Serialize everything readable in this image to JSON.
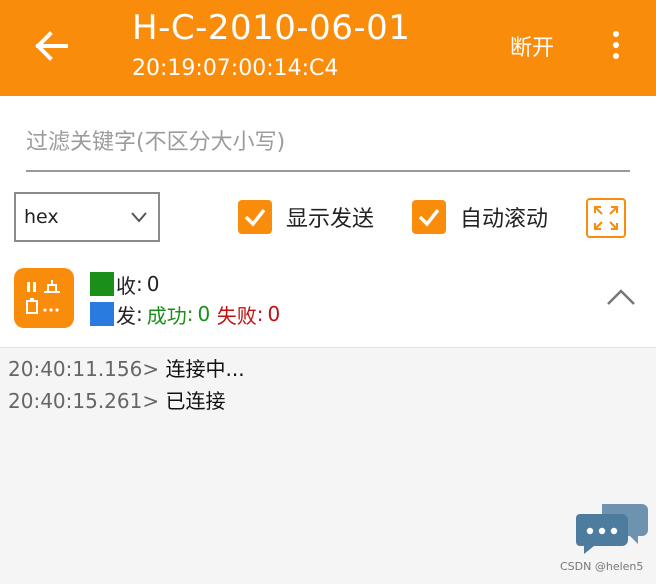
{
  "app_bar": {
    "title": "H-C-2010-06-01",
    "subtitle": "20:19:07:00:14:C4",
    "disconnect_label": "断开",
    "back_icon": "arrow-left-icon",
    "more_icon": "more-vert-icon",
    "color": "#f98c0a"
  },
  "filter": {
    "placeholder": "过滤关键字(不区分大小写)",
    "value": ""
  },
  "controls": {
    "format_select": {
      "selected": "hex"
    },
    "show_send": {
      "label": "显示发送",
      "checked": true
    },
    "auto_scroll": {
      "label": "自动滚动",
      "checked": true
    },
    "fullscreen_icon": "fullscreen-icon"
  },
  "stats": {
    "receive_label": "收",
    "receive_count": "0",
    "receive_color": "#1a8f1a",
    "send_label": "发",
    "send_color": "#2a7be0",
    "success_label": "成功",
    "success_count": "0",
    "fail_label": "失败",
    "fail_count": "0",
    "pause_icon": "pause-clear-icon",
    "collapse_icon": "chevron-up-icon"
  },
  "log": [
    {
      "time": "20:40:11.156>",
      "message": "连接中..."
    },
    {
      "time": "20:40:15.261>",
      "message": "已连接"
    }
  ],
  "watermark": "CSDN @helen5"
}
